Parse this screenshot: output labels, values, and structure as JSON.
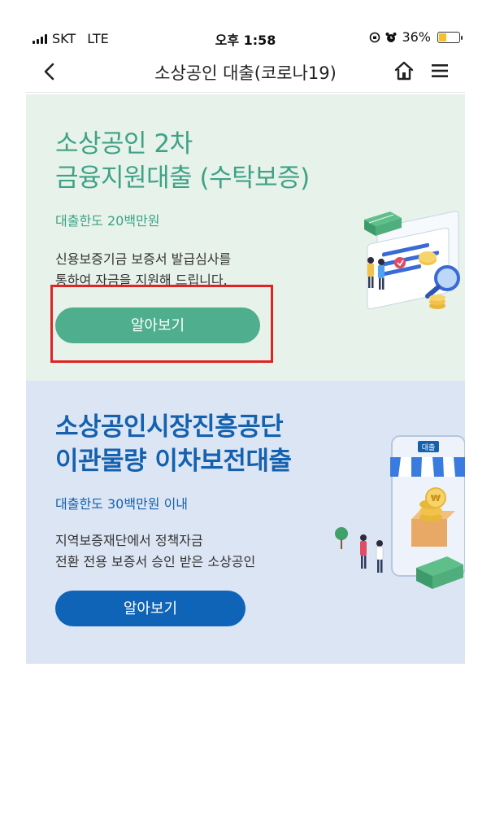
{
  "status_bar": {
    "carrier": "SKT",
    "network": "LTE",
    "time": "오후 1:58",
    "battery": "36%",
    "battery_level": 0.36
  },
  "header": {
    "title": "소상공인 대출(코로나19)"
  },
  "cards": [
    {
      "title_line1": "소상공인 2차",
      "title_line2": "금융지원대출 (수탁보증)",
      "limit": "대출한도 20백만원",
      "desc_line1": "신용보증기금 보증서 발급심사를",
      "desc_line2": "통하여 자금을 지원해 드립니다.",
      "button_label": "알아보기",
      "accent": "#4fae8e"
    },
    {
      "title_line1": "소상공인시장진흥공단",
      "title_line2": "이관물량 이차보전대출",
      "limit": "대출한도 30백만원 이내",
      "desc_line1": "지역보증재단에서 정책자금",
      "desc_line2": "전환 전용 보증서 승인 받은 소상공인",
      "button_label": "알아보기",
      "store_sign": "대출",
      "accent": "#0f64b8"
    }
  ],
  "icons": {
    "back": "chevron-left-icon",
    "home": "home-icon",
    "menu": "hamburger-menu-icon"
  }
}
